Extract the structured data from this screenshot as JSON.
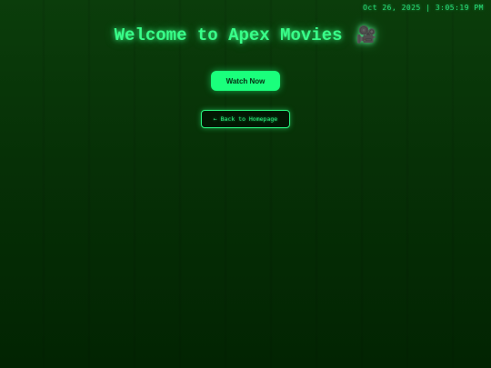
{
  "header": {
    "datetime": "Oct 26, 2025 | 3:05:19 PM"
  },
  "main": {
    "title": "Welcome to Apex Movies",
    "title_icon": "🎥",
    "watch_label": "Watch Now",
    "back_label": "← Back to Homepage"
  },
  "colors": {
    "accent": "#2cff86",
    "background_top": "#0b3d0b",
    "background_bottom": "#022402",
    "button_fill": "#1aff7c",
    "button_text": "#042a10"
  },
  "icons": {
    "title_icon_name": "movie-camera-icon"
  }
}
